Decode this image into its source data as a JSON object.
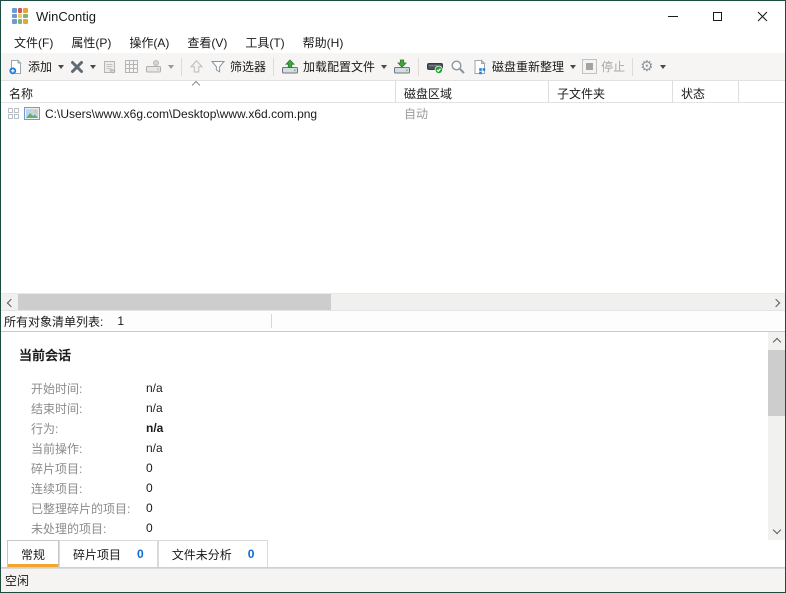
{
  "window": {
    "title": "WinContig"
  },
  "menu": {
    "items": [
      {
        "label": "文件(F)"
      },
      {
        "label": "属性(P)"
      },
      {
        "label": "操作(A)"
      },
      {
        "label": "查看(V)"
      },
      {
        "label": "工具(T)"
      },
      {
        "label": "帮助(H)"
      }
    ]
  },
  "toolbar": {
    "add_label": "添加",
    "filter_label": "筛选器",
    "load_profile_label": "加载配置文件",
    "defrag_label": "磁盘重新整理",
    "stop_label": "停止"
  },
  "list": {
    "columns": [
      "名称",
      "磁盘区域",
      "子文件夹",
      "状态"
    ],
    "rows": [
      {
        "name": "C:\\Users\\www.x6g.com\\Desktop\\www.x6d.com.png",
        "disk_area": "自动",
        "subfolder": "",
        "status": ""
      }
    ]
  },
  "info_bar": {
    "label": "所有对象清单列表:",
    "count": "1"
  },
  "session": {
    "title": "当前会话",
    "rows": [
      {
        "label": "开始时间:",
        "value": "n/a"
      },
      {
        "label": "结束时间:",
        "value": "n/a"
      },
      {
        "label": "行为:",
        "value": "n/a"
      },
      {
        "label": "当前操作:",
        "value": "n/a"
      },
      {
        "label": "碎片项目:",
        "value": "0"
      },
      {
        "label": "连续项目:",
        "value": "0"
      },
      {
        "label": "已整理碎片的项目:",
        "value": "0"
      },
      {
        "label": "未处理的项目:",
        "value": "0"
      }
    ]
  },
  "tabs": [
    {
      "label": "常规"
    },
    {
      "label": "碎片项目",
      "count": "0"
    },
    {
      "label": "文件未分析",
      "count": "0"
    }
  ],
  "status_bar": {
    "text": "空闲"
  },
  "colors": {
    "window_border": "#1d4c40",
    "tab_underline": "#f3a42a",
    "count_blue": "#0a6cd6",
    "accent_green": "#3fa73f",
    "accent_blue": "#2a7fd4"
  }
}
